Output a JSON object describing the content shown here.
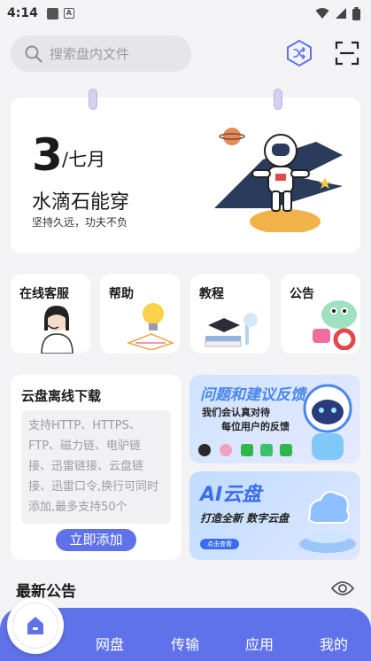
{
  "status_bar": {
    "time": "4:14"
  },
  "search": {
    "placeholder": "搜索盘内文件"
  },
  "hero": {
    "day": "3",
    "month": "/七月",
    "slogan": "水滴石能穿",
    "subtitle": "坚持久远，功夫不负"
  },
  "quick_links": [
    {
      "label": "在线客服"
    },
    {
      "label": "帮助"
    },
    {
      "label": "教程"
    },
    {
      "label": "公告"
    }
  ],
  "offline_download": {
    "title": "云盘离线下载",
    "placeholder": "支持HTTP、HTTPS、FTP、磁力链、电驴链接、迅雷链接、云盘链接、迅雷口令,换行可同时添加,最多支持50个",
    "button": "立即添加"
  },
  "feedback_banner": {
    "title": "问题和建议反馈",
    "line1": "我们会认真对待",
    "line2": "每位用户的反馈"
  },
  "ai_banner": {
    "title": "AI云盘",
    "subtitle": "打造全新 数字云盘",
    "button": "点击查看"
  },
  "notice": {
    "title": "最新公告"
  },
  "tab_bar": {
    "tabs": [
      "网盘",
      "传输",
      "应用",
      "我的"
    ]
  },
  "colors": {
    "accent": "#5f72ea",
    "background": "#f3f3f6"
  }
}
